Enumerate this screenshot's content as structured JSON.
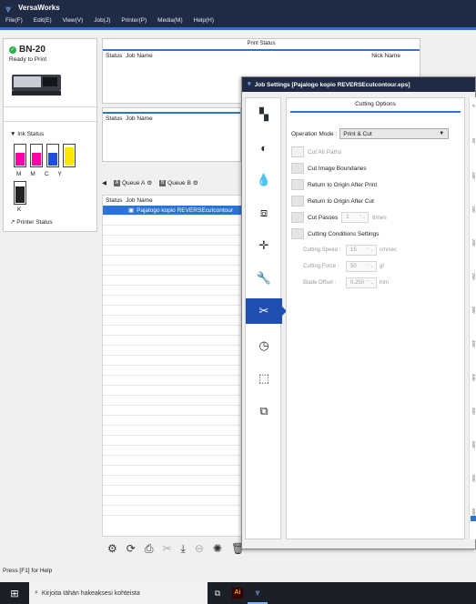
{
  "app": {
    "title": "VersaWorks"
  },
  "menu": [
    "File(F)",
    "Edit(E)",
    "View(V)",
    "Job(J)",
    "Printer(P)",
    "Media(M)",
    "Help(H)"
  ],
  "printer": {
    "name": "BN-20",
    "status": "Ready to Print",
    "ink_status_label": "Ink Status",
    "inks": [
      {
        "label": "M",
        "color": "#ff00a8",
        "level": 0.6
      },
      {
        "label": "M",
        "color": "#ff00a8",
        "level": 0.6
      },
      {
        "label": "C",
        "color": "#1e4de0",
        "level": 0.6
      },
      {
        "label": "Y",
        "color": "#ffe600",
        "level": 0.85
      }
    ],
    "ink_k": {
      "label": "K",
      "color": "#222222",
      "level": 0.75
    },
    "status_link": "Printer Status"
  },
  "print_status": {
    "title": "Print Status",
    "col_status": "Status",
    "col_job": "Job Name",
    "col_nick": "Nick Name"
  },
  "second_panel": {
    "col_status": "Status",
    "col_job": "Job Name"
  },
  "queues": {
    "tabs": [
      {
        "icon": "A",
        "label": "Queue A"
      },
      {
        "icon": "B",
        "label": "Queue B"
      }
    ],
    "col_status": "Status",
    "col_job": "Job Name",
    "selected_job": "Pajalogo kopio REVERSEcutcontour"
  },
  "help_text": "Press [F1] for Help",
  "taskbar": {
    "search_placeholder": "Kirjoita tähän hakeaksesi kohteista"
  },
  "dialog": {
    "title": "Job Settings [Pajalogo kopio REVERSEcutcontour.eps]",
    "section": "Cutting Options",
    "operation_mode_label": "Operation Mode :",
    "operation_mode_value": "Print & Cut",
    "options": [
      {
        "label": "Cut All Paths",
        "enabled": false
      },
      {
        "label": "Cut Image Boundaries",
        "enabled": true
      },
      {
        "label": "Return to Origin After Print",
        "enabled": true
      },
      {
        "label": "Return to Origin After Cut",
        "enabled": true
      }
    ],
    "cut_passes": {
      "label": "Cut Passes",
      "value": "1",
      "unit": "times"
    },
    "conditions_label": "Cutting Conditions Settings",
    "cutting_speed": {
      "label": "Cutting Speed :",
      "value": "15",
      "unit": "cm/sec"
    },
    "cutting_force": {
      "label": "Cutting Force :",
      "value": "50",
      "unit": "gf"
    },
    "blade_offset": {
      "label": "Blade Offset :",
      "value": "0.250",
      "unit": "mm"
    },
    "ruler_ticks": [
      "0",
      "50",
      "100",
      "150",
      "200",
      "250",
      "300",
      "350",
      "400",
      "450",
      "500",
      "550",
      "600"
    ]
  }
}
